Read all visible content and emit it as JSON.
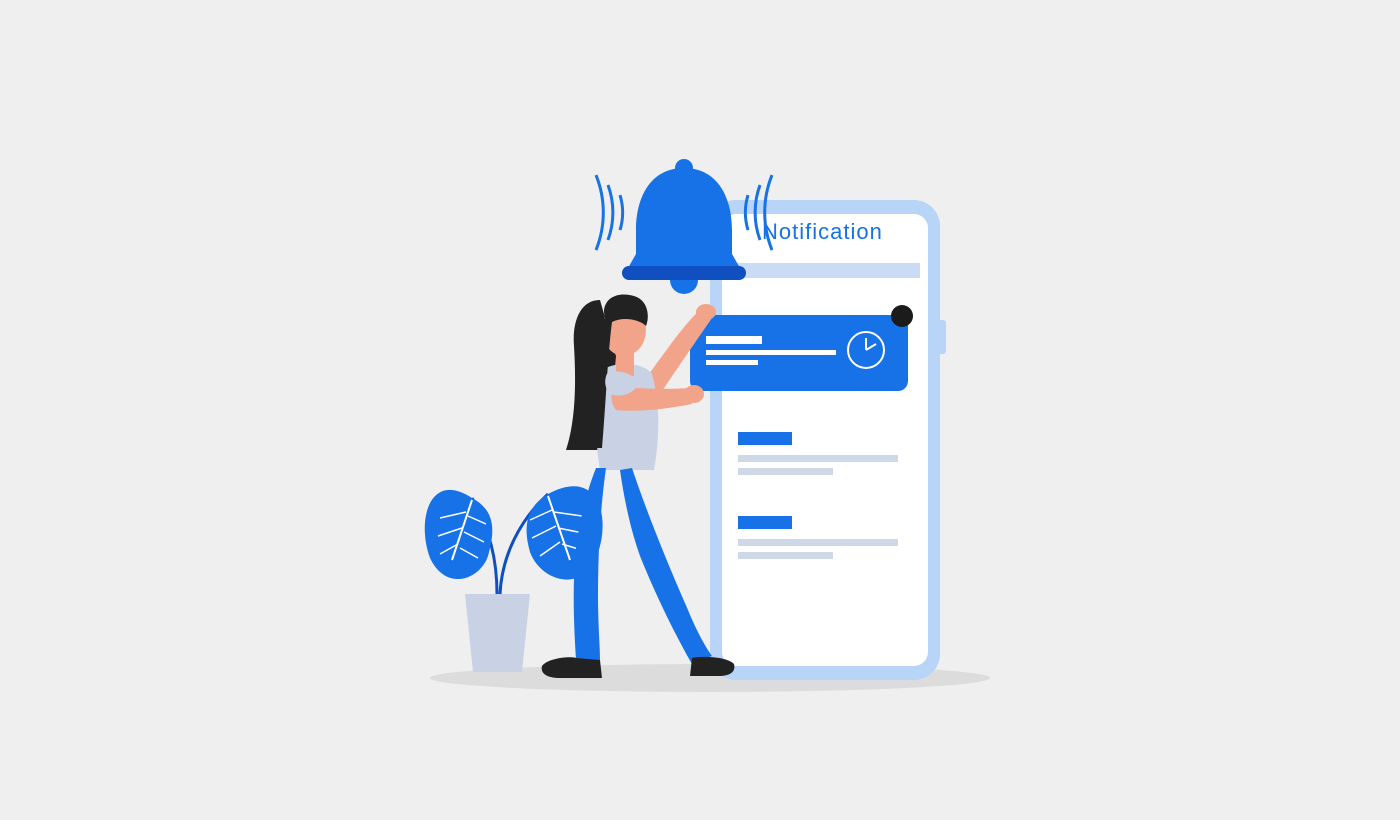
{
  "illustration": {
    "label": "Notification",
    "icons": {
      "bell": "bell-icon",
      "clock": "clock-icon",
      "badge": "notification-badge"
    },
    "colors": {
      "primary": "#1672e6",
      "primary_dark": "#0f4fbf",
      "primary_light": "#b8d4f7",
      "screen": "#ffffff",
      "background": "#efefef",
      "skin": "#f2a48a",
      "hair": "#222222",
      "shoes": "#222222",
      "dot": "#1b1b1b",
      "shadow": "#d6d6d6",
      "pot": "#c9d2e4"
    }
  }
}
